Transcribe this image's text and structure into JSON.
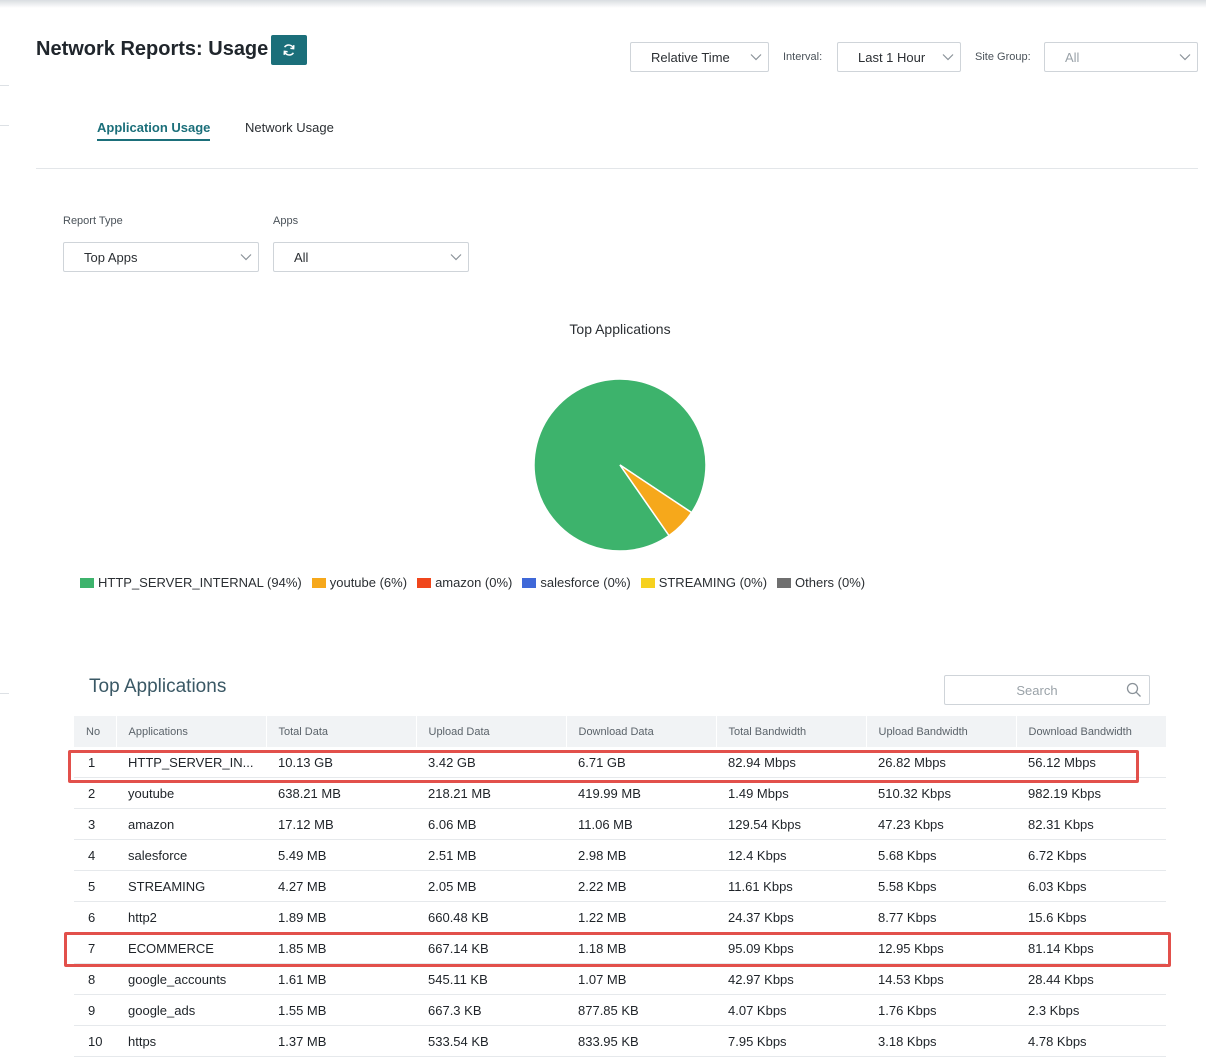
{
  "header": {
    "title": "Network Reports: Usage",
    "time_mode": "Relative Time",
    "interval_label": "Interval:",
    "interval_value": "Last 1 Hour",
    "site_group_label": "Site Group:",
    "site_group_value": "All"
  },
  "tabs": [
    {
      "label": "Application Usage",
      "active": true
    },
    {
      "label": "Network Usage",
      "active": false
    }
  ],
  "filters": {
    "report_type_label": "Report Type",
    "report_type_value": "Top Apps",
    "apps_label": "Apps",
    "apps_value": "All"
  },
  "chart_data": {
    "type": "pie",
    "title": "Top Applications",
    "slices": [
      {
        "label": "HTTP_SERVER_INTERNAL (94%)",
        "name": "HTTP_SERVER_INTERNAL",
        "value": 94,
        "color": "#3db36c"
      },
      {
        "label": "youtube (6%)",
        "name": "youtube",
        "value": 6,
        "color": "#f6a81b"
      },
      {
        "label": "amazon (0%)",
        "name": "amazon",
        "value": 0,
        "color": "#f0461c"
      },
      {
        "label": "salesforce (0%)",
        "name": "salesforce",
        "value": 0,
        "color": "#3f68d8"
      },
      {
        "label": "STREAMING (0%)",
        "name": "STREAMING",
        "value": 0,
        "color": "#f6d11f"
      },
      {
        "label": "Others (0%)",
        "name": "Others",
        "value": 0,
        "color": "#6f6f6f"
      }
    ]
  },
  "table": {
    "title": "Top Applications",
    "search_placeholder": "Search",
    "columns": [
      "No",
      "Applications",
      "Total Data",
      "Upload Data",
      "Download Data",
      "Total Bandwidth",
      "Upload Bandwidth",
      "Download Bandwidth"
    ],
    "rows": [
      [
        "1",
        "HTTP_SERVER_IN...",
        "10.13 GB",
        "3.42 GB",
        "6.71 GB",
        "82.94 Mbps",
        "26.82 Mbps",
        "56.12 Mbps"
      ],
      [
        "2",
        "youtube",
        "638.21 MB",
        "218.21 MB",
        "419.99 MB",
        "1.49 Mbps",
        "510.32 Kbps",
        "982.19 Kbps"
      ],
      [
        "3",
        "amazon",
        "17.12 MB",
        "6.06 MB",
        "11.06 MB",
        "129.54 Kbps",
        "47.23 Kbps",
        "82.31 Kbps"
      ],
      [
        "4",
        "salesforce",
        "5.49 MB",
        "2.51 MB",
        "2.98 MB",
        "12.4 Kbps",
        "5.68 Kbps",
        "6.72 Kbps"
      ],
      [
        "5",
        "STREAMING",
        "4.27 MB",
        "2.05 MB",
        "2.22 MB",
        "11.61 Kbps",
        "5.58 Kbps",
        "6.03 Kbps"
      ],
      [
        "6",
        "http2",
        "1.89 MB",
        "660.48 KB",
        "1.22 MB",
        "24.37 Kbps",
        "8.77 Kbps",
        "15.6 Kbps"
      ],
      [
        "7",
        "ECOMMERCE",
        "1.85 MB",
        "667.14 KB",
        "1.18 MB",
        "95.09 Kbps",
        "12.95 Kbps",
        "81.14 Kbps"
      ],
      [
        "8",
        "google_accounts",
        "1.61 MB",
        "545.11 KB",
        "1.07 MB",
        "42.97 Kbps",
        "14.53 Kbps",
        "28.44 Kbps"
      ],
      [
        "9",
        "google_ads",
        "1.55 MB",
        "667.3 KB",
        "877.85 KB",
        "4.07 Kbps",
        "1.76 Kbps",
        "2.3 Kbps"
      ],
      [
        "10",
        "https",
        "1.37 MB",
        "533.54 KB",
        "833.95 KB",
        "7.95 Kbps",
        "3.18 Kbps",
        "4.78 Kbps"
      ]
    ],
    "highlighted_rows": [
      1,
      7
    ],
    "highlight_color": "#e2504b"
  },
  "colors": {
    "accent": "#1b6f7a"
  },
  "icons": [
    "refresh-icon",
    "chevron-down-icon",
    "search-icon"
  ]
}
